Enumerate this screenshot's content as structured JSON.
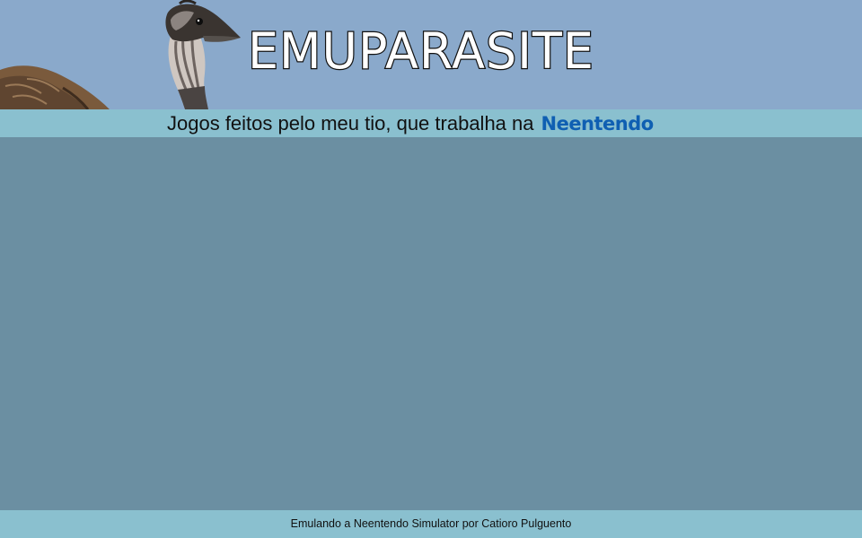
{
  "header": {
    "site_title": "EMUPARASITE",
    "banner_image": "emu-bird-illustration",
    "colors": {
      "sky": "#8aa9cb",
      "title_fill": "#ffffff",
      "title_outline": "#111111"
    }
  },
  "tagline": {
    "text": "Jogos feitos pelo meu tio, que trabalha na",
    "brand": "Neentendo",
    "brand_color": "#0f5fb2",
    "bar_color": "#8ac0cf"
  },
  "main": {
    "background": "#6b8fa2"
  },
  "footer": {
    "text": "Emulando a Neentendo Simulator por Catioro Pulguento",
    "bar_color": "#8ac0cf"
  }
}
